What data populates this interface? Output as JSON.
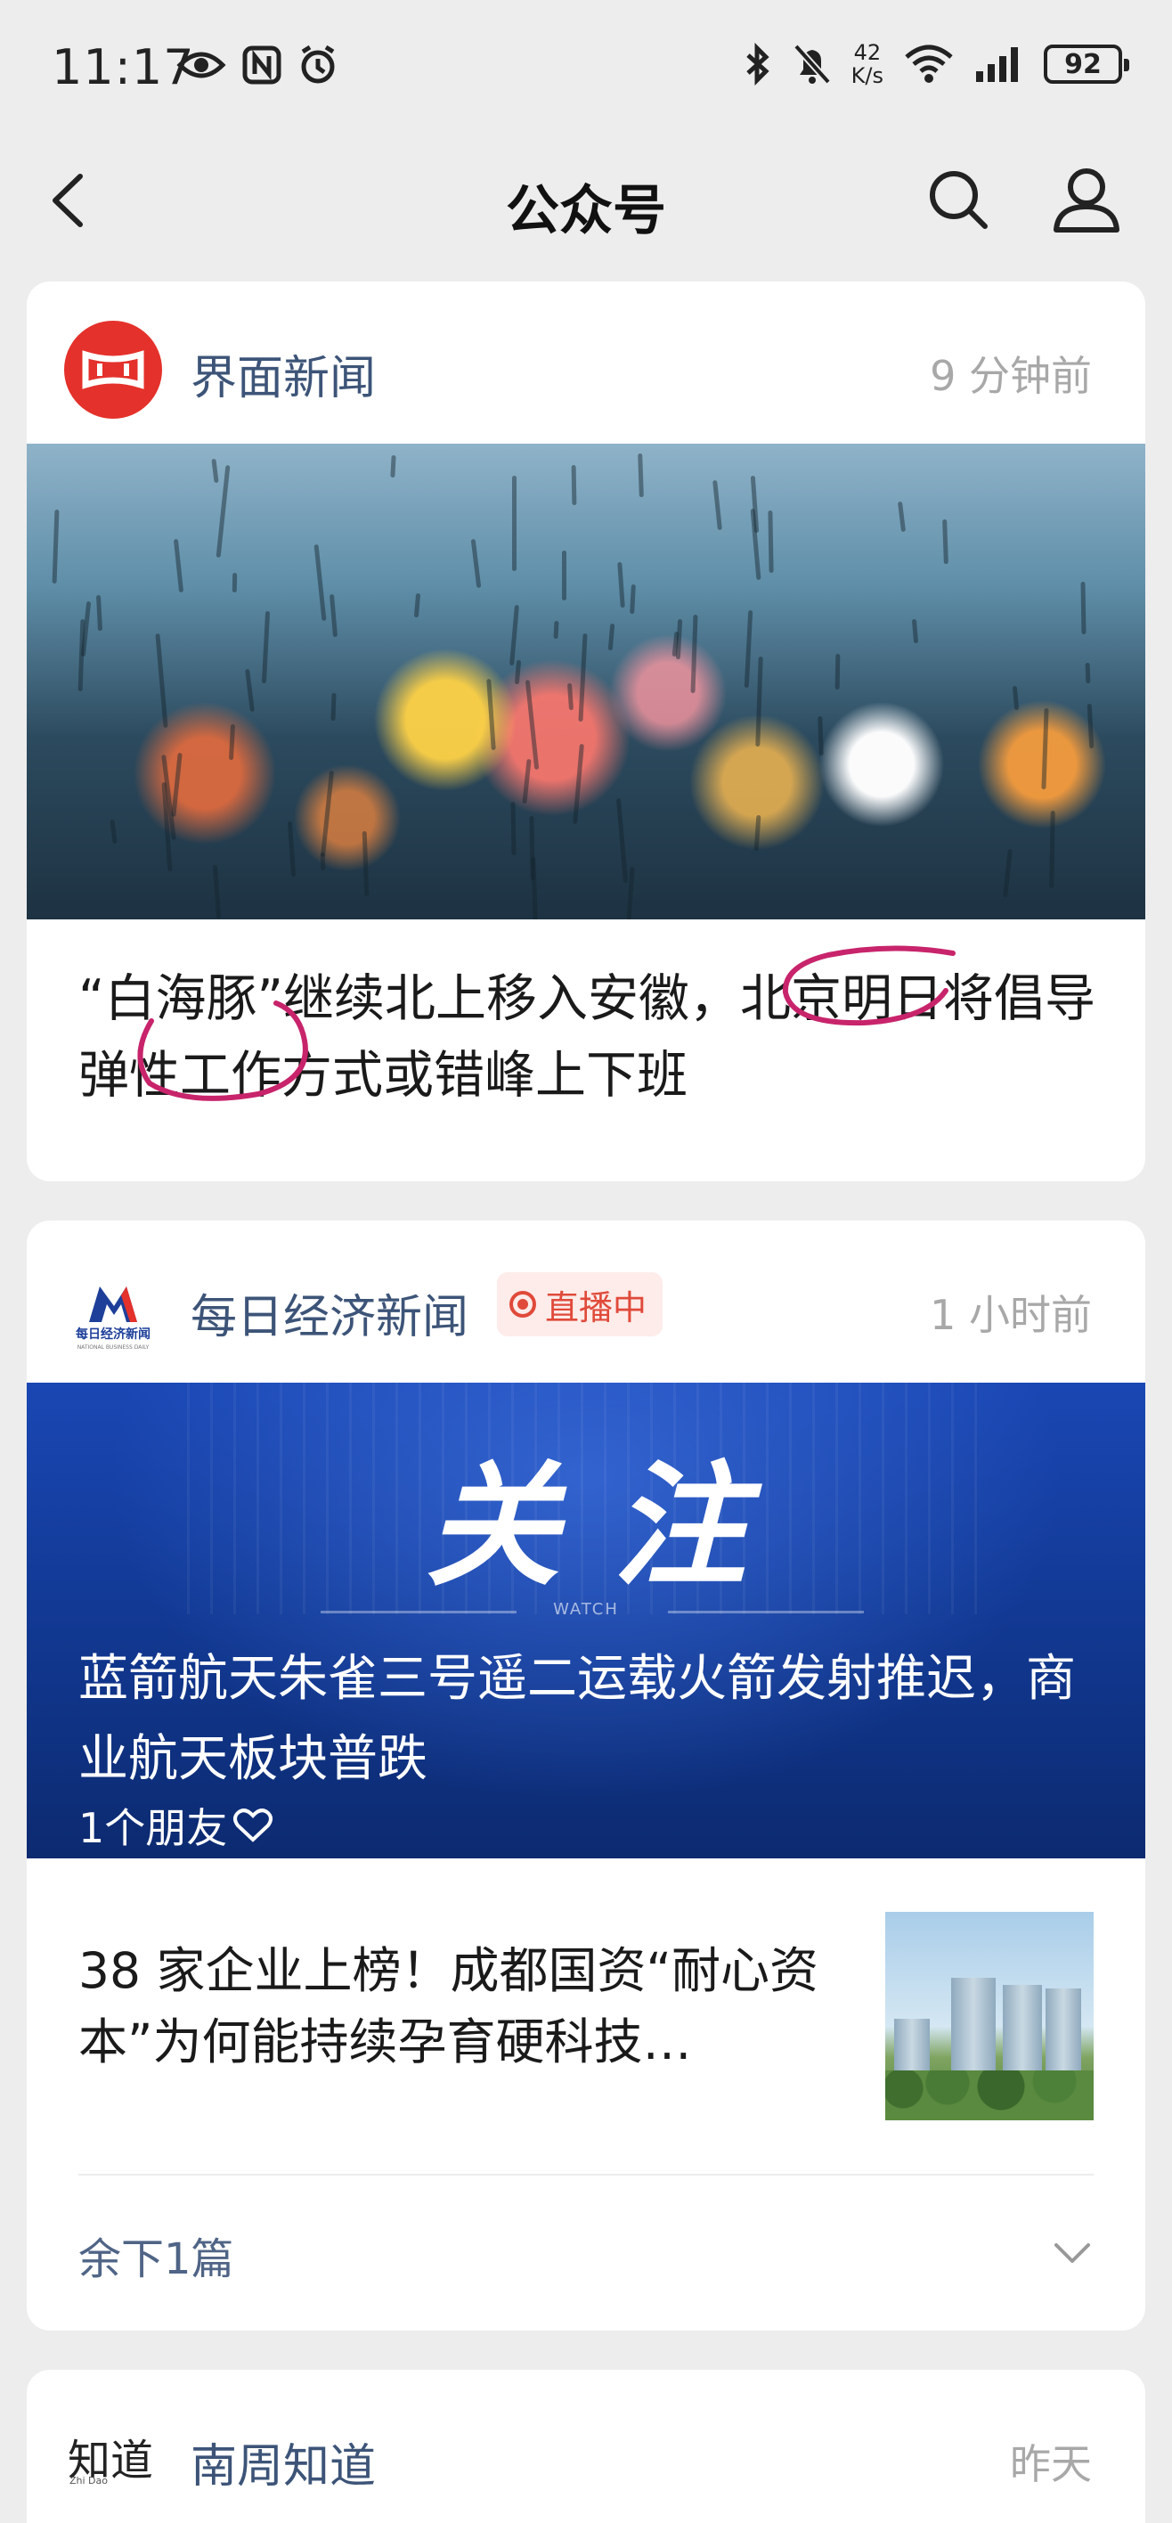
{
  "status_bar": {
    "time": "11:17",
    "net_speed_value": "42",
    "net_speed_unit": "K/s",
    "battery": "92",
    "icons": [
      "eye-icon",
      "nfc-icon",
      "alarm-icon",
      "bluetooth-icon",
      "mute-icon",
      "wifi-icon",
      "signal-icon"
    ]
  },
  "nav": {
    "title": "公众号",
    "icons": [
      "back-icon",
      "search-icon",
      "profile-icon"
    ]
  },
  "feed": [
    {
      "account": "界面新闻",
      "time": "9 分钟前",
      "title": "“白海豚”继续北上移入安徽，北京明日将倡导弹性工作方式或错峰上下班",
      "brand_color": "#e4312b"
    },
    {
      "account": "每日经济新闻",
      "live_badge": "直播中",
      "time": "1 小时前",
      "cover": {
        "banner_text": "关注",
        "watch_text": "WATCH",
        "title": "蓝箭航天朱雀三号遥二运载火箭发射推迟，商业航天板块普跌",
        "friends": "1个朋友"
      },
      "sub_article": {
        "title": "38 家企业上榜！成都国资“耐心资本”为何能持续孕育硬科技…"
      },
      "remaining": "余下1篇",
      "logo_caption": "每日经济新闻",
      "logo_caption_en": "NATIONAL BUSINESS DAILY"
    },
    {
      "account": "南周知道",
      "time": "昨天",
      "logo_text": "知道",
      "logo_caption": "Zhi Dao"
    }
  ],
  "colors": {
    "account_name": "#3d5478",
    "annotation": "#c8246b",
    "live": "#e04a3a"
  }
}
